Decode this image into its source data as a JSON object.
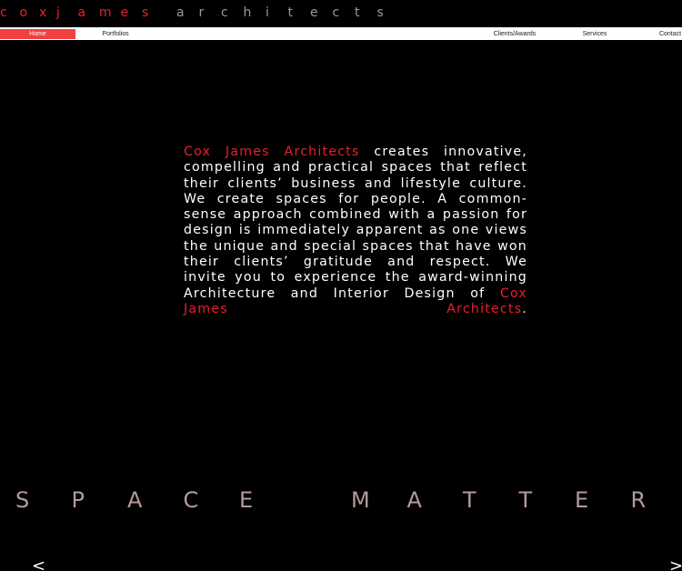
{
  "logo": {
    "word1": "cox",
    "word2": "james",
    "word3": "architects"
  },
  "nav": {
    "items": [
      {
        "label": "Home",
        "active": true
      },
      {
        "label": "Portfolios",
        "active": false
      },
      {
        "label": "Clients/Awards",
        "active": false
      },
      {
        "label": "Services",
        "active": false
      },
      {
        "label": "Contact",
        "active": false
      }
    ]
  },
  "intro": {
    "brand1": "Cox James Architects",
    "body": " creates innovative, compelling and practical spaces that reflect their clients’ business and lifestyle culture. We create spaces for people. A common-sense approach combined with a passion for design is immediately apparent as one views the unique and special spaces that have won their clients’ gratitude and respect. We invite you to experience the award-winning Architecture and Interior Design of ",
    "brand2": "Cox James Architects",
    "end": "."
  },
  "tagline": {
    "text": "SPACE MATTERS"
  },
  "controls": {
    "prev": "<",
    "next": ">"
  },
  "colors": {
    "accent": "#e8202a",
    "nav_active": "#f04040",
    "tagline": "#b59a9a",
    "logo_grey": "#9a9a9a"
  }
}
